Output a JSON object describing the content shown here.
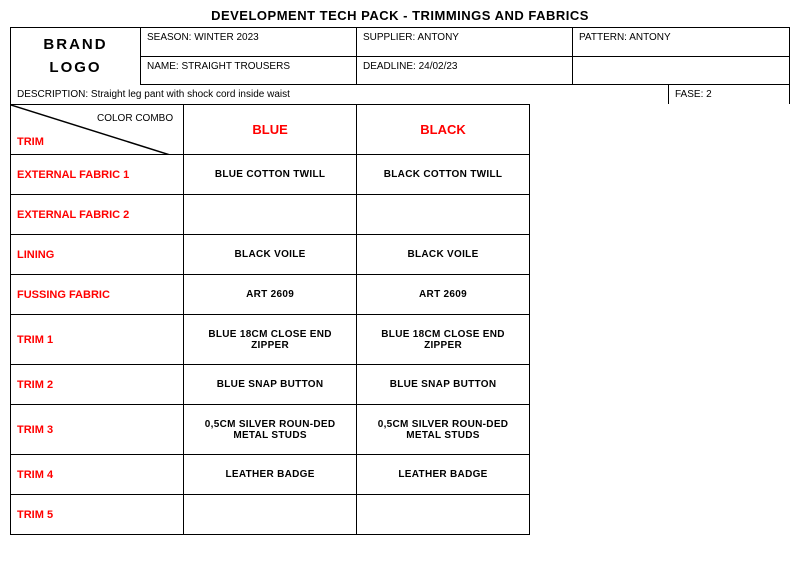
{
  "page": {
    "title": "DEVELOPMENT TECH PACK - TRIMMINGS AND FABRICS",
    "header": {
      "brand_logo": "BRAND\nLOGO",
      "season_label": "SEASON: WINTER 2023",
      "supplier_label": "SUPPLIER: ANTONY",
      "name_label": "NAME: STRAIGHT TROUSERS",
      "deadline_label": "DEADLINE: 24/02/23",
      "pattern_label": "PATTERN: ANTONY",
      "description_label": "DESCRIPTION: Straight leg pant with shock cord inside waist",
      "fase_label": "FASE: 2"
    },
    "table": {
      "color_combo_label": "COLOR COMBO",
      "trim_label": "TRIM",
      "columns": [
        "BLUE",
        "BLACK"
      ],
      "rows": [
        {
          "label": "EXTERNAL FABRIC 1",
          "values": [
            "BLUE COTTON TWILL",
            "BLACK COTTON TWILL"
          ]
        },
        {
          "label": "EXTERNAL FABRIC 2",
          "values": [
            "",
            ""
          ]
        },
        {
          "label": "LINING",
          "values": [
            "BLACK VOILE",
            "BLACK VOILE"
          ]
        },
        {
          "label": "FUSSING FABRIC",
          "values": [
            "ART 2609",
            "ART 2609"
          ]
        },
        {
          "label": "TRIM 1",
          "values": [
            "BLUE 18CM CLOSE END ZIPPER",
            "BLUE 18CM CLOSE END ZIPPER"
          ]
        },
        {
          "label": "TRIM 2",
          "values": [
            "BLUE SNAP BUTTON",
            "BLUE SNAP BUTTON"
          ]
        },
        {
          "label": "TRIM 3",
          "values": [
            "0,5CM SILVER ROUN-DED METAL STUDS",
            "0,5CM SILVER ROUN-DED METAL STUDS"
          ]
        },
        {
          "label": "TRIM 4",
          "values": [
            "LEATHER BADGE",
            "LEATHER BADGE"
          ]
        },
        {
          "label": "TRIM 5",
          "values": [
            "",
            ""
          ]
        }
      ]
    }
  }
}
